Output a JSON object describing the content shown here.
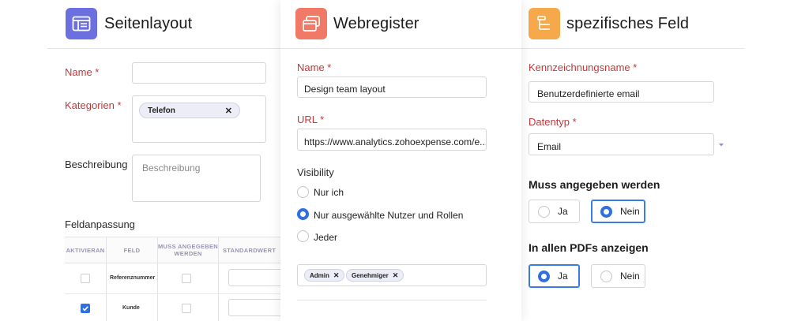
{
  "colors": {
    "accent": "#2f6fe0",
    "required_label": "#c0393b",
    "icon1_bg": "#6b6fe0",
    "icon2_bg": "#f07a66",
    "icon3_bg": "#f6a94b"
  },
  "panel1": {
    "title": "Seitenlayout",
    "icon": "layout-icon",
    "name_label": "Name *",
    "categories_label": "Kategorien *",
    "category_chip": "Telefon",
    "description_label": "Beschreibung",
    "description_placeholder": "Beschreibung",
    "field_custom_title": "Feldanpassung",
    "table": {
      "headers": [
        "AKTIVIERAN",
        "FELD",
        "MUSS ANGEGEBEN WERDEN",
        "STANDARDWERT"
      ],
      "rows": [
        {
          "field": "Referenznummer",
          "active": false
        },
        {
          "field": "Kunde",
          "active": true
        }
      ]
    }
  },
  "panel2": {
    "title": "Webregister",
    "icon": "windows-icon",
    "name_label": "Name *",
    "name_value": "Design team layout",
    "url_label": "URL *",
    "url_value": "https://www.analytics.zohoexpense.com/e...",
    "visibility_label": "Visibility",
    "visibility_options": [
      "Nur ich",
      "Nur ausgewählte Nutzer und Rollen",
      "Jeder"
    ],
    "visibility_selected": "Nur ausgewählte Nutzer und Rollen",
    "chips": [
      "Admin",
      "Genehmiger"
    ]
  },
  "panel3": {
    "title": "spezifisches Feld",
    "icon": "field-icon",
    "label_name_label": "Kennzeichnungsname *",
    "label_name_value": "Benutzerdefinierte email",
    "datatype_label": "Datentyp *",
    "datatype_value": "Email",
    "mandatory_label": "Muss angegeben werden",
    "mandatory_yes": "Ja",
    "mandatory_no": "Nein",
    "mandatory_selected": "Nein",
    "pdf_label": "In allen PDFs anzeigen",
    "pdf_yes": "Ja",
    "pdf_no": "Nein",
    "pdf_selected": "Ja"
  }
}
